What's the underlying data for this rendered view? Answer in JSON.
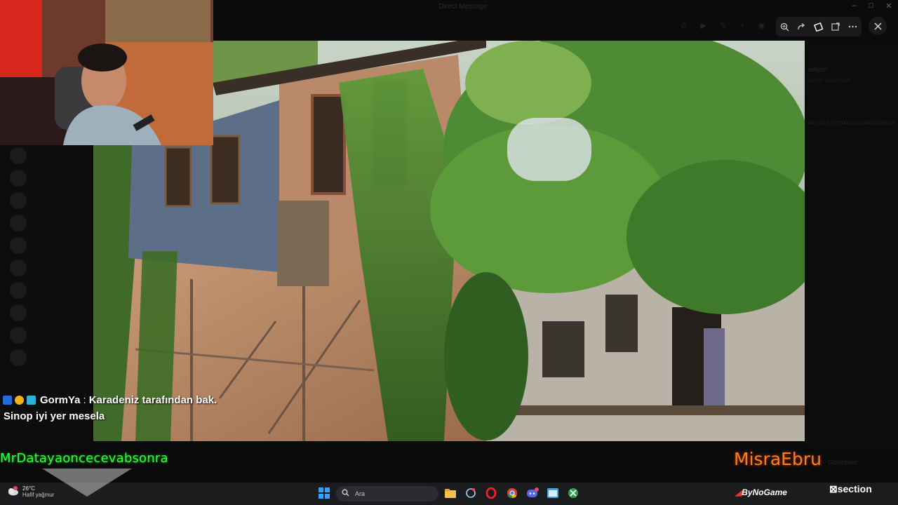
{
  "background_app": {
    "title": "Direct Message",
    "right_panel": [
      "ediyor!",
      "ıscher ünseknyer",
      "bluntoya jnenoduusı pakkandamah",
      "Görüntüler"
    ]
  },
  "viewer_toolbar": {
    "icons": [
      "zoom-in-icon",
      "rotate-icon",
      "crop-icon",
      "expand-icon",
      "more-icon"
    ],
    "close_icon": "close-icon"
  },
  "window_controls": [
    "–",
    "□",
    "✕"
  ],
  "chat": {
    "user": "GormYa",
    "separator": ":",
    "message_line1": "Karadeniz tarafından bak.",
    "message_line2": "Sinop iyi yer mesela",
    "badges": [
      "#1f6fd6",
      "#f2b21a",
      "#2fb0d8"
    ]
  },
  "overlay_names": {
    "green": "MrDatayaoncecevabsonra",
    "orange": "MisraEbru"
  },
  "taskbar": {
    "weather_temp": "26°C",
    "weather_desc": "Hafif yağmur",
    "search_placeholder": "Ara",
    "apps": [
      {
        "icon": "file-explorer-icon",
        "color": "#f2c14a",
        "glyph": "▬"
      },
      {
        "icon": "snipping-icon",
        "color": "#3f9fe0",
        "glyph": "◌"
      },
      {
        "icon": "opera-icon",
        "color": "#ff1b2d",
        "glyph": "O"
      },
      {
        "icon": "chrome-icon",
        "color": "#3fae4b",
        "glyph": "●"
      },
      {
        "icon": "discord-icon",
        "color": "#5865f2",
        "glyph": "◕"
      },
      {
        "icon": "explorer-window-icon",
        "color": "#4aa3df",
        "glyph": "▭"
      },
      {
        "icon": "xbox-icon",
        "color": "#2e9e4f",
        "glyph": "◍"
      }
    ],
    "sponsor": "ByNoGame",
    "logo": "section"
  }
}
